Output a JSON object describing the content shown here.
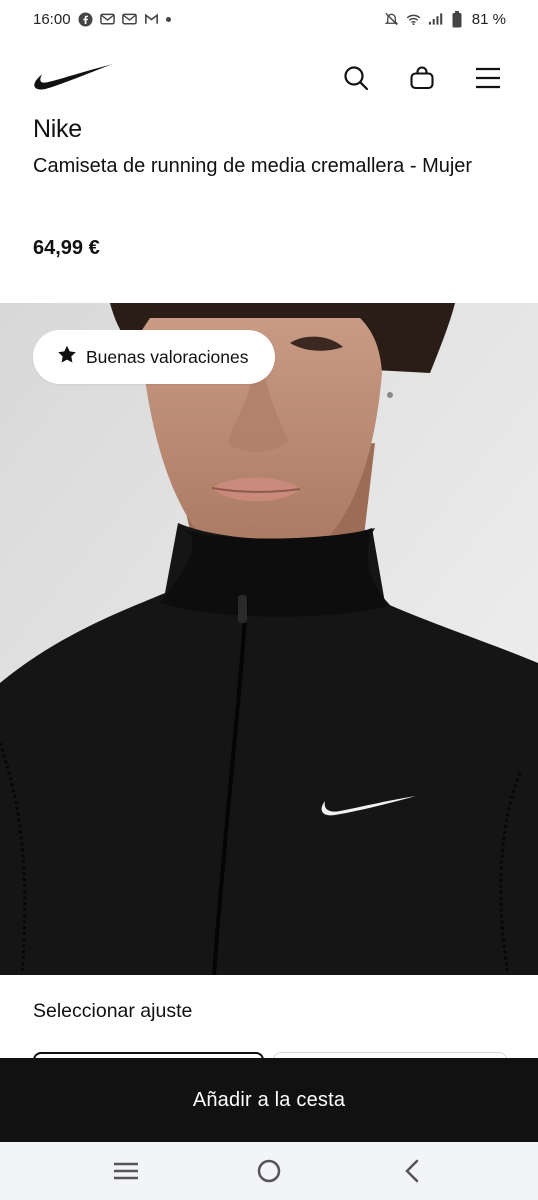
{
  "status_bar": {
    "time": "16:00",
    "battery": "81 %",
    "left_icons": [
      "facebook-icon",
      "mail-icon",
      "mail-icon",
      "gmail-icon"
    ],
    "right_icons": [
      "mute-icon",
      "wifi-icon",
      "signal-icon",
      "battery-icon"
    ]
  },
  "header": {
    "logo": "nike-swoosh-logo",
    "actions": [
      "search-icon",
      "bag-icon",
      "menu-icon"
    ]
  },
  "product": {
    "brand": "Nike",
    "title": "Camiseta de running de media cremallera - Mujer",
    "price": "64,99 €",
    "rating_badge": "Buenas valoraciones"
  },
  "sizes": {
    "heading": "Seleccionar ajuste"
  },
  "cta": {
    "label": "Añadir a la cesta"
  },
  "colors": {
    "black": "#111111",
    "nav_background": "#f3f4f7",
    "shirt": "#151515"
  }
}
